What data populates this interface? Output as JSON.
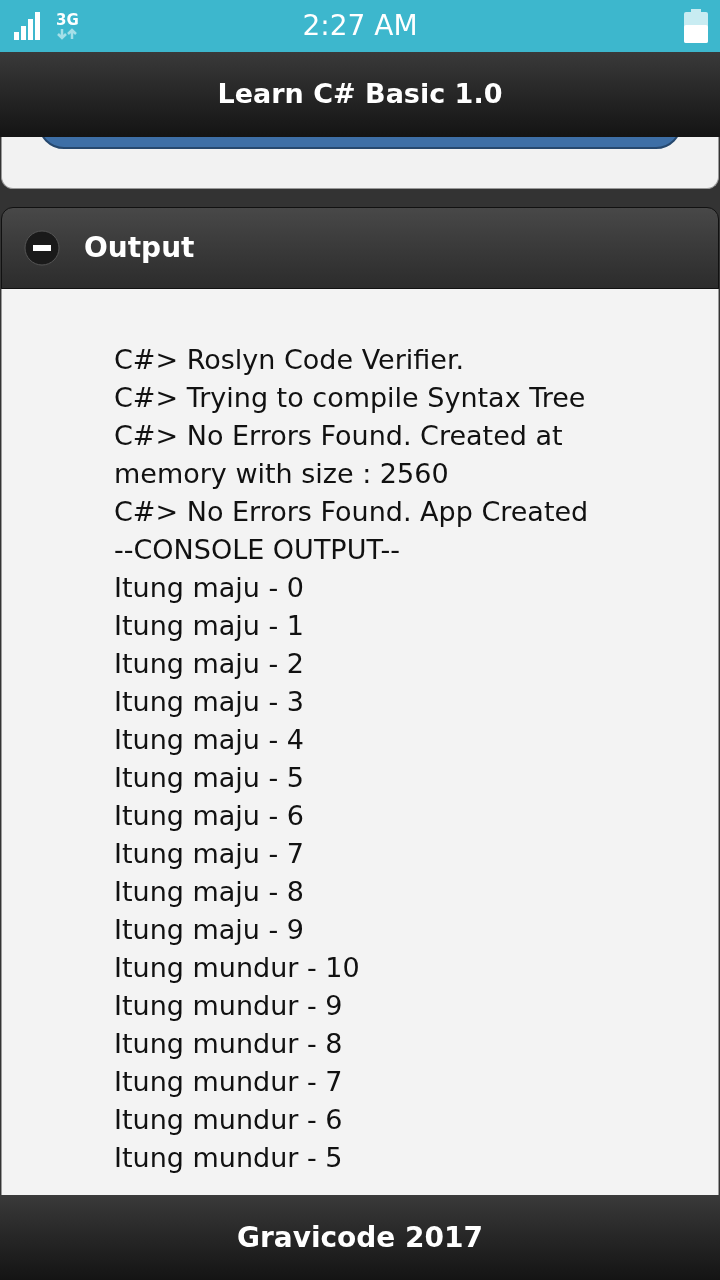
{
  "status_bar": {
    "network": "3G",
    "time": "2:27 AM"
  },
  "header": {
    "title": "Learn C# Basic 1.0"
  },
  "output_panel": {
    "title": "Output",
    "expanded": true,
    "lines": [
      "C#> Roslyn Code Verifier.",
      "C#> Trying to compile Syntax Tree",
      "C#> No Errors Found. Created at memory with size : 2560",
      "C#> No Errors Found. App Created",
      "--CONSOLE OUTPUT--",
      "Itung maju - 0",
      "Itung maju - 1",
      "Itung maju - 2",
      "Itung maju - 3",
      "Itung maju - 4",
      "Itung maju - 5",
      "Itung maju - 6",
      "Itung maju - 7",
      "Itung maju - 8",
      "Itung maju - 9",
      "Itung mundur - 10",
      "Itung mundur - 9",
      "Itung mundur - 8",
      "Itung mundur - 7",
      "Itung mundur - 6",
      "Itung mundur - 5"
    ]
  },
  "footer": {
    "text": "Gravicode 2017"
  }
}
